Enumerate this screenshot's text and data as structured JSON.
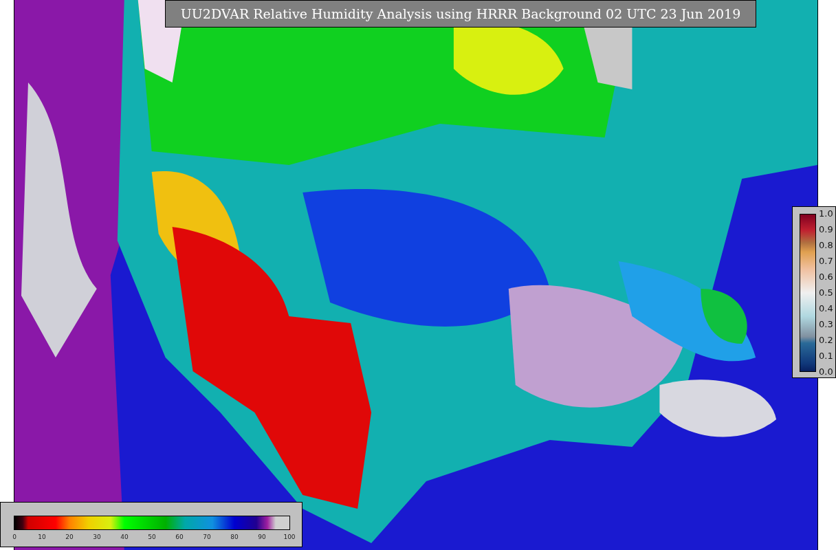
{
  "title": "UU2DVAR Relative Humidity Analysis using HRRR Background 02 UTC 23 Jun 2019",
  "humidity_scale": {
    "ticks": [
      "0",
      "10",
      "20",
      "30",
      "40",
      "50",
      "60",
      "70",
      "80",
      "90",
      "100"
    ]
  },
  "observation_scale": {
    "ticks": [
      "1.0",
      "0.9",
      "0.8",
      "0.7",
      "0.6",
      "0.5",
      "0.4",
      "0.3",
      "0.2",
      "0.1",
      "0.0"
    ]
  }
}
